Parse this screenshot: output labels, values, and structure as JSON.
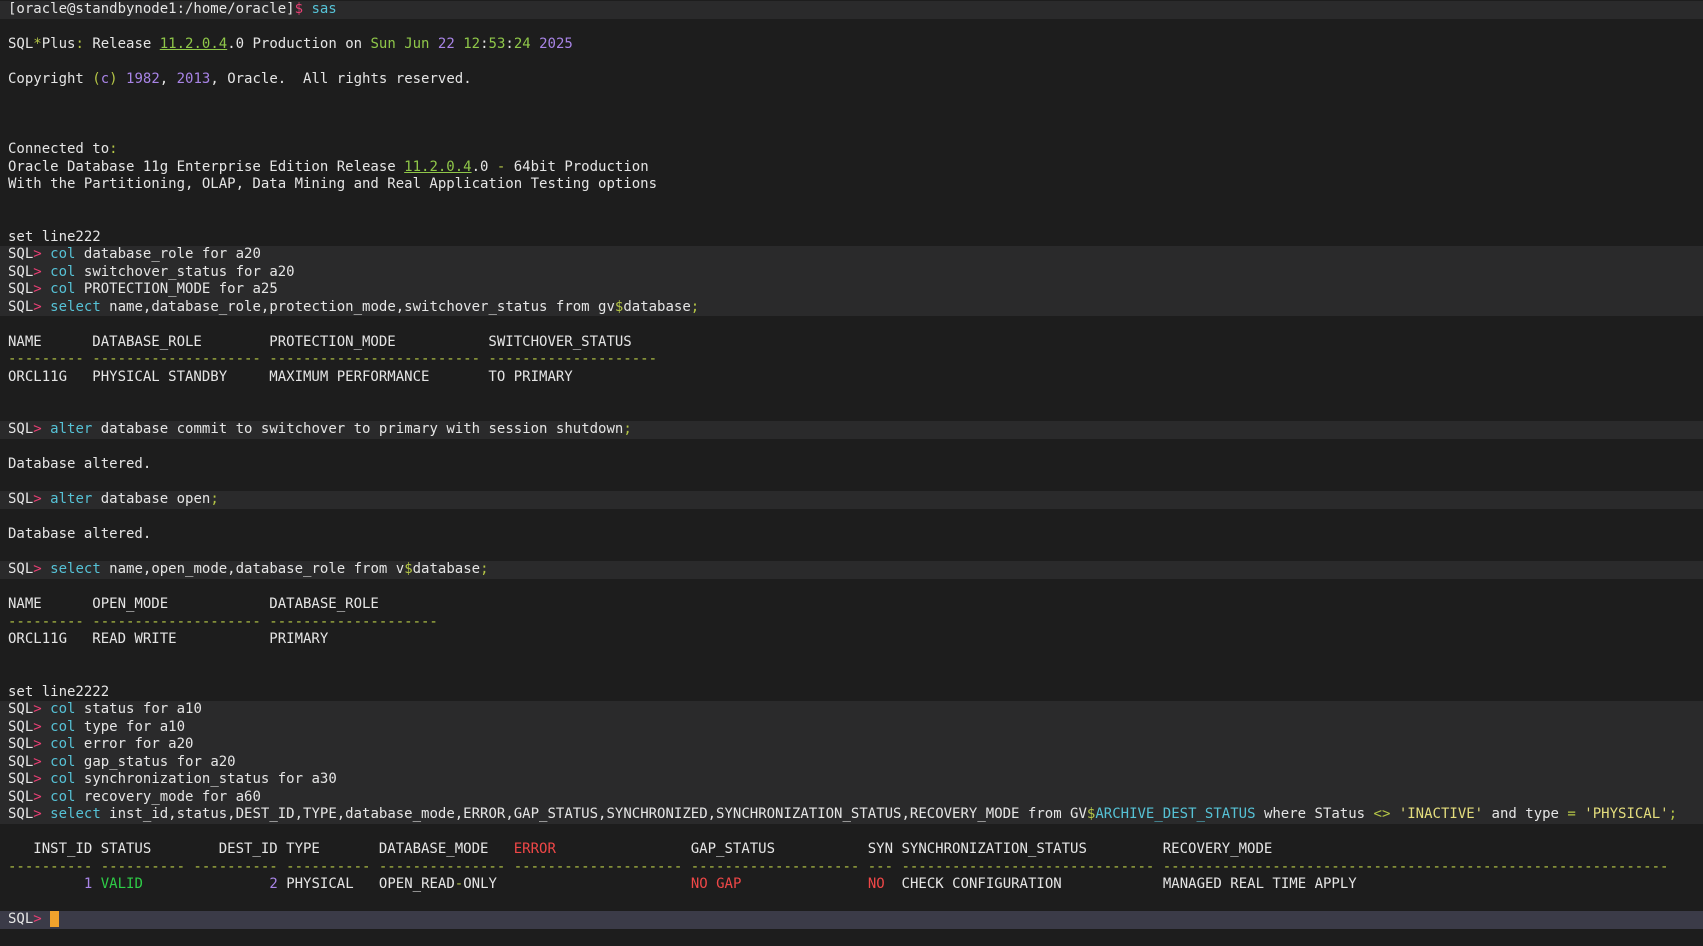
{
  "terminal": {
    "app": "sqlplus-terminal-session",
    "palette": {
      "background": "#1d1d1d",
      "command_row_bg": "#2a2a2b",
      "prompt_row_bg": "#3b3b48",
      "fg": "#e5e5e5",
      "cyan": "#56c2d6",
      "pink": "#e93f74",
      "lime": "#b5c646",
      "green": "#8fc749",
      "green2": "#2ecc47",
      "purple": "#a884e6",
      "yellow": "#e4dd7d",
      "red": "#ef4747",
      "cursor": "#f0a22c"
    },
    "lines": [
      {
        "name": "shell-prompt-line",
        "bg": "cmd",
        "tokens": [
          {
            "t": "[oracle@standbynode1:/home/oracle]",
            "c": "fg"
          },
          {
            "t": "$",
            "c": "pink"
          },
          {
            "t": " ",
            "c": "fg"
          },
          {
            "t": "sas",
            "c": "cyan"
          }
        ]
      },
      {
        "name": "blank-line",
        "bg": "none",
        "tokens": []
      },
      {
        "name": "sqlplus-banner",
        "bg": "none",
        "tokens": [
          {
            "t": "SQL",
            "c": "fg"
          },
          {
            "t": "*",
            "c": "lime"
          },
          {
            "t": "Plus",
            "c": "fg"
          },
          {
            "t": ":",
            "c": "lime"
          },
          {
            "t": " Release ",
            "c": "fg"
          },
          {
            "t": "11.2.0.4",
            "c": "green",
            "u": true
          },
          {
            "t": ".0 Production on ",
            "c": "fg"
          },
          {
            "t": "Sun Jun ",
            "c": "green"
          },
          {
            "t": "22",
            "c": "purple"
          },
          {
            "t": " ",
            "c": "fg"
          },
          {
            "t": "12",
            "c": "green"
          },
          {
            "t": ":",
            "c": "fg"
          },
          {
            "t": "53",
            "c": "green"
          },
          {
            "t": ":",
            "c": "fg"
          },
          {
            "t": "24",
            "c": "green"
          },
          {
            "t": " ",
            "c": "fg"
          },
          {
            "t": "2025",
            "c": "purple"
          }
        ]
      },
      {
        "name": "blank-line",
        "bg": "none",
        "tokens": []
      },
      {
        "name": "copyright-line",
        "bg": "none",
        "tokens": [
          {
            "t": "Copyright ",
            "c": "fg"
          },
          {
            "t": "(",
            "c": "lime"
          },
          {
            "t": "c",
            "c": "purple"
          },
          {
            "t": ")",
            "c": "lime"
          },
          {
            "t": " ",
            "c": "fg"
          },
          {
            "t": "1982",
            "c": "purple"
          },
          {
            "t": ", ",
            "c": "fg"
          },
          {
            "t": "2013",
            "c": "purple"
          },
          {
            "t": ", Oracle.  All rights reserved.",
            "c": "fg"
          }
        ]
      },
      {
        "name": "blank-line",
        "bg": "none",
        "tokens": []
      },
      {
        "name": "blank-line",
        "bg": "none",
        "tokens": []
      },
      {
        "name": "blank-line",
        "bg": "none",
        "tokens": []
      },
      {
        "name": "connected-to",
        "bg": "none",
        "tokens": [
          {
            "t": "Connected to",
            "c": "fg"
          },
          {
            "t": ":",
            "c": "lime"
          }
        ]
      },
      {
        "name": "db-version-line",
        "bg": "none",
        "tokens": [
          {
            "t": "Oracle Database 11g Enterprise Edition Release ",
            "c": "fg"
          },
          {
            "t": "11.2.0.4",
            "c": "green",
            "u": true
          },
          {
            "t": ".0 ",
            "c": "fg"
          },
          {
            "t": "-",
            "c": "lime"
          },
          {
            "t": " 64bit Production",
            "c": "fg"
          }
        ]
      },
      {
        "name": "db-options-line",
        "bg": "none",
        "tokens": [
          {
            "t": "With the Partitioning, OLAP, Data Mining and Real Application Testing options",
            "c": "fg"
          }
        ]
      },
      {
        "name": "blank-line",
        "bg": "none",
        "tokens": []
      },
      {
        "name": "blank-line",
        "bg": "none",
        "tokens": []
      },
      {
        "name": "set-linesize-222",
        "bg": "none",
        "tokens": [
          {
            "t": "set line222",
            "c": "fg"
          }
        ]
      },
      {
        "name": "cmd-col-database-role",
        "bg": "cmd",
        "tokens": [
          {
            "t": "SQL",
            "c": "fg"
          },
          {
            "t": ">",
            "c": "pink"
          },
          {
            "t": " ",
            "c": "fg"
          },
          {
            "t": "col",
            "c": "cyan"
          },
          {
            "t": " database_role for a20",
            "c": "fg"
          }
        ]
      },
      {
        "name": "cmd-col-switchover-status",
        "bg": "cmd",
        "tokens": [
          {
            "t": "SQL",
            "c": "fg"
          },
          {
            "t": ">",
            "c": "pink"
          },
          {
            "t": " ",
            "c": "fg"
          },
          {
            "t": "col",
            "c": "cyan"
          },
          {
            "t": " switchover_status for a20",
            "c": "fg"
          }
        ]
      },
      {
        "name": "cmd-col-protection-mode",
        "bg": "cmd",
        "tokens": [
          {
            "t": "SQL",
            "c": "fg"
          },
          {
            "t": ">",
            "c": "pink"
          },
          {
            "t": " ",
            "c": "fg"
          },
          {
            "t": "col",
            "c": "cyan"
          },
          {
            "t": " PROTECTION_MODE for a25",
            "c": "fg"
          }
        ]
      },
      {
        "name": "cmd-select-gv-database",
        "bg": "cmd",
        "tokens": [
          {
            "t": "SQL",
            "c": "fg"
          },
          {
            "t": ">",
            "c": "pink"
          },
          {
            "t": " ",
            "c": "fg"
          },
          {
            "t": "select",
            "c": "cyan"
          },
          {
            "t": " name,database_role,protection_mode,switchover_status from gv",
            "c": "fg"
          },
          {
            "t": "$",
            "c": "lime"
          },
          {
            "t": "database",
            "c": "fg"
          },
          {
            "t": ";",
            "c": "lime"
          }
        ]
      },
      {
        "name": "blank-line",
        "bg": "none",
        "tokens": []
      },
      {
        "name": "result1-header",
        "bg": "none",
        "tokens": [
          {
            "t": "NAME      DATABASE_ROLE        PROTECTION_MODE           SWITCHOVER_STATUS",
            "c": "fg"
          }
        ]
      },
      {
        "name": "result1-separator",
        "bg": "none",
        "tokens": [
          {
            "t": "--------- -------------------- ------------------------- --------------------",
            "c": "lime"
          }
        ]
      },
      {
        "name": "result1-row",
        "bg": "none",
        "tokens": [
          {
            "t": "ORCL11G   PHYSICAL STANDBY     MAXIMUM PERFORMANCE       TO PRIMARY",
            "c": "fg"
          }
        ]
      },
      {
        "name": "blank-line",
        "bg": "none",
        "tokens": []
      },
      {
        "name": "blank-line",
        "bg": "none",
        "tokens": []
      },
      {
        "name": "cmd-alter-switchover",
        "bg": "cmd",
        "tokens": [
          {
            "t": "SQL",
            "c": "fg"
          },
          {
            "t": ">",
            "c": "pink"
          },
          {
            "t": " ",
            "c": "fg"
          },
          {
            "t": "alter",
            "c": "cyan"
          },
          {
            "t": " database commit to switchover to primary with session shutdown",
            "c": "fg"
          },
          {
            "t": ";",
            "c": "lime"
          }
        ]
      },
      {
        "name": "blank-line",
        "bg": "none",
        "tokens": []
      },
      {
        "name": "db-altered-message-1",
        "bg": "none",
        "tokens": [
          {
            "t": "Database altered.",
            "c": "fg"
          }
        ]
      },
      {
        "name": "blank-line",
        "bg": "none",
        "tokens": []
      },
      {
        "name": "cmd-alter-open",
        "bg": "cmd",
        "tokens": [
          {
            "t": "SQL",
            "c": "fg"
          },
          {
            "t": ">",
            "c": "pink"
          },
          {
            "t": " ",
            "c": "fg"
          },
          {
            "t": "alter",
            "c": "cyan"
          },
          {
            "t": " database open",
            "c": "fg"
          },
          {
            "t": ";",
            "c": "lime"
          }
        ]
      },
      {
        "name": "blank-line",
        "bg": "none",
        "tokens": []
      },
      {
        "name": "db-altered-message-2",
        "bg": "none",
        "tokens": [
          {
            "t": "Database altered.",
            "c": "fg"
          }
        ]
      },
      {
        "name": "blank-line",
        "bg": "none",
        "tokens": []
      },
      {
        "name": "cmd-select-v-database",
        "bg": "cmd",
        "tokens": [
          {
            "t": "SQL",
            "c": "fg"
          },
          {
            "t": ">",
            "c": "pink"
          },
          {
            "t": " ",
            "c": "fg"
          },
          {
            "t": "select",
            "c": "cyan"
          },
          {
            "t": " name,open_mode,database_role from v",
            "c": "fg"
          },
          {
            "t": "$",
            "c": "lime"
          },
          {
            "t": "database",
            "c": "fg"
          },
          {
            "t": ";",
            "c": "lime"
          }
        ]
      },
      {
        "name": "blank-line",
        "bg": "none",
        "tokens": []
      },
      {
        "name": "result2-header",
        "bg": "none",
        "tokens": [
          {
            "t": "NAME      OPEN_MODE            DATABASE_ROLE",
            "c": "fg"
          }
        ]
      },
      {
        "name": "result2-separator",
        "bg": "none",
        "tokens": [
          {
            "t": "--------- -------------------- --------------------",
            "c": "lime"
          }
        ]
      },
      {
        "name": "result2-row",
        "bg": "none",
        "tokens": [
          {
            "t": "ORCL11G   READ WRITE           PRIMARY",
            "c": "fg"
          }
        ]
      },
      {
        "name": "blank-line",
        "bg": "none",
        "tokens": []
      },
      {
        "name": "blank-line",
        "bg": "none",
        "tokens": []
      },
      {
        "name": "set-linesize-2222",
        "bg": "none",
        "tokens": [
          {
            "t": "set line2222",
            "c": "fg"
          }
        ]
      },
      {
        "name": "cmd-col-status",
        "bg": "cmd",
        "tokens": [
          {
            "t": "SQL",
            "c": "fg"
          },
          {
            "t": ">",
            "c": "pink"
          },
          {
            "t": " ",
            "c": "fg"
          },
          {
            "t": "col",
            "c": "cyan"
          },
          {
            "t": " status for a10",
            "c": "fg"
          }
        ]
      },
      {
        "name": "cmd-col-type",
        "bg": "cmd",
        "tokens": [
          {
            "t": "SQL",
            "c": "fg"
          },
          {
            "t": ">",
            "c": "pink"
          },
          {
            "t": " ",
            "c": "fg"
          },
          {
            "t": "col",
            "c": "cyan"
          },
          {
            "t": " type for a10",
            "c": "fg"
          }
        ]
      },
      {
        "name": "cmd-col-error",
        "bg": "cmd",
        "tokens": [
          {
            "t": "SQL",
            "c": "fg"
          },
          {
            "t": ">",
            "c": "pink"
          },
          {
            "t": " ",
            "c": "fg"
          },
          {
            "t": "col",
            "c": "cyan"
          },
          {
            "t": " error for a20",
            "c": "fg"
          }
        ]
      },
      {
        "name": "cmd-col-gap-status",
        "bg": "cmd",
        "tokens": [
          {
            "t": "SQL",
            "c": "fg"
          },
          {
            "t": ">",
            "c": "pink"
          },
          {
            "t": " ",
            "c": "fg"
          },
          {
            "t": "col",
            "c": "cyan"
          },
          {
            "t": " gap_status for a20",
            "c": "fg"
          }
        ]
      },
      {
        "name": "cmd-col-synchronization-status",
        "bg": "cmd",
        "tokens": [
          {
            "t": "SQL",
            "c": "fg"
          },
          {
            "t": ">",
            "c": "pink"
          },
          {
            "t": " ",
            "c": "fg"
          },
          {
            "t": "col",
            "c": "cyan"
          },
          {
            "t": " synchronization_status for a30",
            "c": "fg"
          }
        ]
      },
      {
        "name": "cmd-col-recovery-mode",
        "bg": "cmd",
        "tokens": [
          {
            "t": "SQL",
            "c": "fg"
          },
          {
            "t": ">",
            "c": "pink"
          },
          {
            "t": " ",
            "c": "fg"
          },
          {
            "t": "col",
            "c": "cyan"
          },
          {
            "t": " recovery_mode for a60",
            "c": "fg"
          }
        ]
      },
      {
        "name": "cmd-select-archive-dest-status",
        "bg": "cmd",
        "tokens": [
          {
            "t": "SQL",
            "c": "fg"
          },
          {
            "t": ">",
            "c": "pink"
          },
          {
            "t": " ",
            "c": "fg"
          },
          {
            "t": "select",
            "c": "cyan"
          },
          {
            "t": " inst_id,status,DEST_ID,TYPE,database_mode,ERROR,GAP_STATUS,SYNCHRONIZED,SYNCHRONIZATION_STATUS,RECOVERY_MODE from GV",
            "c": "fg"
          },
          {
            "t": "$",
            "c": "lime"
          },
          {
            "t": "ARCHIVE_DEST_STATUS",
            "c": "cyan"
          },
          {
            "t": " where STatus ",
            "c": "fg"
          },
          {
            "t": "<>",
            "c": "lime"
          },
          {
            "t": " ",
            "c": "fg"
          },
          {
            "t": "'INACTIVE'",
            "c": "yellow"
          },
          {
            "t": " and type ",
            "c": "fg"
          },
          {
            "t": "=",
            "c": "lime"
          },
          {
            "t": " ",
            "c": "fg"
          },
          {
            "t": "'PHYSICAL'",
            "c": "yellow"
          },
          {
            "t": ";",
            "c": "lime"
          }
        ]
      },
      {
        "name": "blank-line",
        "bg": "none",
        "tokens": []
      },
      {
        "name": "result3-header",
        "bg": "none",
        "tokens": [
          {
            "t": "   INST_ID STATUS        DEST_ID TYPE       DATABASE_MODE   ",
            "c": "fg"
          },
          {
            "t": "ERROR",
            "c": "red"
          },
          {
            "t": "                GAP_STATUS           SYN SYNCHRONIZATION_STATUS         RECOVERY_MODE",
            "c": "fg"
          }
        ]
      },
      {
        "name": "result3-separator",
        "bg": "none",
        "tokens": [
          {
            "t": "---------- ---------- ---------- ---------- --------------- -------------------- -------------------- --- ------------------------------ ------------------------------------------------------------",
            "c": "lime"
          }
        ]
      },
      {
        "name": "result3-row",
        "bg": "none",
        "tokens": [
          {
            "t": "         ",
            "c": "fg"
          },
          {
            "t": "1",
            "c": "purple"
          },
          {
            "t": " ",
            "c": "fg"
          },
          {
            "t": "VALID",
            "c": "green2"
          },
          {
            "t": "               ",
            "c": "fg"
          },
          {
            "t": "2",
            "c": "purple"
          },
          {
            "t": " ",
            "c": "fg"
          },
          {
            "t": "PHYSICAL   ",
            "c": "fg"
          },
          {
            "t": "OPEN_READ",
            "c": "fg"
          },
          {
            "t": "-",
            "c": "lime"
          },
          {
            "t": "ONLY",
            "c": "fg"
          },
          {
            "t": "                       ",
            "c": "fg"
          },
          {
            "t": "NO GAP",
            "c": "red"
          },
          {
            "t": "               ",
            "c": "fg"
          },
          {
            "t": "NO",
            "c": "red"
          },
          {
            "t": "  ",
            "c": "fg"
          },
          {
            "t": "CHECK CONFIGURATION",
            "c": "fg"
          },
          {
            "t": "            ",
            "c": "fg"
          },
          {
            "t": "MANAGED REAL TIME APPLY",
            "c": "fg"
          }
        ]
      },
      {
        "name": "blank-line",
        "bg": "none",
        "tokens": []
      },
      {
        "name": "sqlplus-prompt-line",
        "bg": "prompt",
        "interactable": true,
        "tokens": [
          {
            "t": "SQL",
            "c": "fg"
          },
          {
            "t": ">",
            "c": "pink"
          },
          {
            "t": " ",
            "c": "fg"
          },
          {
            "t": " ",
            "c": "fg",
            "cursor": true
          }
        ]
      },
      {
        "name": "blank-line",
        "bg": "none",
        "tokens": []
      }
    ]
  }
}
